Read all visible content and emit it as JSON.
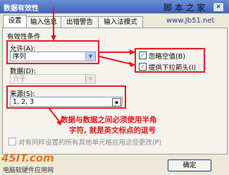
{
  "window": {
    "title": "数据有效性",
    "close_symbol": "✕"
  },
  "watermark": {
    "top": "脚 本 之 家",
    "url": "www.Jb51.net",
    "bottom_brand": "电脑软硬件应用网",
    "bottom_logo": "45IT.com"
  },
  "tabs": [
    {
      "label": "设置",
      "active": true
    },
    {
      "label": "输入信息",
      "active": false
    },
    {
      "label": "出错警告",
      "active": false
    },
    {
      "label": "输入法模式",
      "active": false
    }
  ],
  "settings": {
    "group_title": "有效性条件",
    "allow_label": "允许(A):",
    "allow_value": "序列",
    "data_label": "数据(D):",
    "data_value": "介于",
    "ignore_blank_label": "忽略空值(B)",
    "ignore_blank_checked": true,
    "dropdown_label": "提供下拉箭头(I)",
    "dropdown_checked": true,
    "source_label": "来源(S):",
    "source_value": "1, 2, 3",
    "apply_all_label": "对有同样设置的所有其他单元格应用这些更改(P)",
    "apply_all_checked": false
  },
  "annotation": {
    "line1": "数据与数据之间必须使用半角",
    "line2": "字符, 就是英文标点的逗号"
  },
  "buttons": {
    "ok": "确定"
  }
}
